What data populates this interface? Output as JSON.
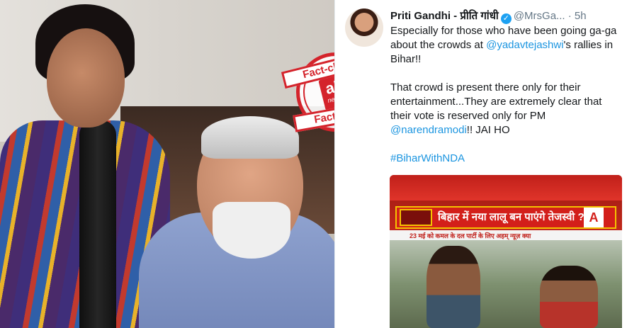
{
  "stamp": {
    "top_text": "Fact-check",
    "bottom_text": "Fact-check",
    "logo_text": "alt",
    "logo_sub": "news"
  },
  "tweet": {
    "name": "Priti Gandhi - प्रीति गांधी",
    "handle": "@MrsGa...",
    "time": "· 5h",
    "line1_pre": "Especially for those who have been going ga-ga about the crowds at ",
    "mention1": "@yadavtejashwi",
    "line1_post": "'s rallies in Bihar!!",
    "line2_pre": "That crowd is present there only for their entertainment...They are extremely clear that their vote is reserved only for PM ",
    "mention2": "@narendramodi",
    "line2_post": "!! JAI HO",
    "hashtag": "#BiharWithNDA"
  },
  "video": {
    "headline": "बिहार में नया लालू बन पाएंगे तेजस्वी ?",
    "logo": "A",
    "ticker": "23 मई को कमल के दल पार्टी के लिए अहम् न्यूज़ क्या"
  },
  "colors": {
    "link": "#1b95e0",
    "stamp_red": "#d4232b",
    "verified": "#1da1f2"
  },
  "icons": [
    "verified-badge-icon"
  ]
}
